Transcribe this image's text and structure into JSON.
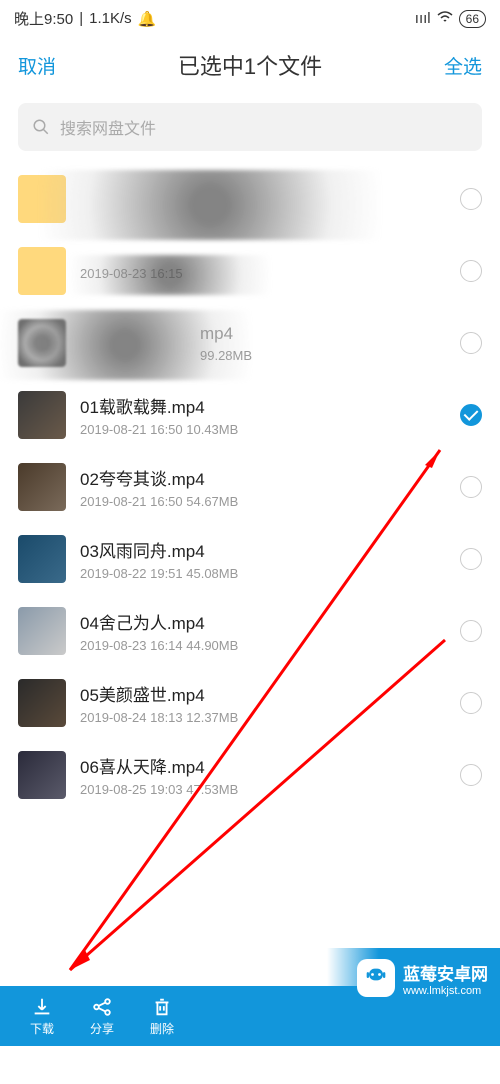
{
  "status": {
    "time": "晚上9:50",
    "speed": "1.1K/s",
    "battery": "66"
  },
  "header": {
    "cancel": "取消",
    "title": "已选中1个文件",
    "select_all": "全选"
  },
  "search": {
    "placeholder": "搜索网盘文件"
  },
  "files": [
    {
      "name": "",
      "meta": "",
      "redacted": true,
      "selected": false,
      "thumb_style": "folder"
    },
    {
      "name": "",
      "meta": "2019-08-23  16:15",
      "redacted": true,
      "selected": false,
      "thumb_style": "folder"
    },
    {
      "name": "",
      "meta": "99.28MB",
      "suffix": "mp4",
      "redacted": true,
      "selected": false,
      "thumb_style": "scribble"
    },
    {
      "name": "01载歌载舞.mp4",
      "meta": "2019-08-21  16:50   10.43MB",
      "selected": true,
      "thumb_style": "video1"
    },
    {
      "name": "02夸夸其谈.mp4",
      "meta": "2019-08-21  16:50   54.67MB",
      "selected": false,
      "thumb_style": "video2"
    },
    {
      "name": "03风雨同舟.mp4",
      "meta": "2019-08-22  19:51   45.08MB",
      "selected": false,
      "thumb_style": "video3"
    },
    {
      "name": "04舍己为人.mp4",
      "meta": "2019-08-23  16:14   44.90MB",
      "selected": false,
      "thumb_style": "video4"
    },
    {
      "name": "05美颜盛世.mp4",
      "meta": "2019-08-24  18:13   12.37MB",
      "selected": false,
      "thumb_style": "video5"
    },
    {
      "name": "06喜从天降.mp4",
      "meta": "2019-08-25  19:03   47.53MB",
      "selected": false,
      "thumb_style": "video6"
    }
  ],
  "bottom": {
    "download": "下载",
    "share": "分享",
    "delete": "删除"
  },
  "watermark": {
    "title": "蓝莓安卓网",
    "url": "www.lmkjst.com"
  }
}
